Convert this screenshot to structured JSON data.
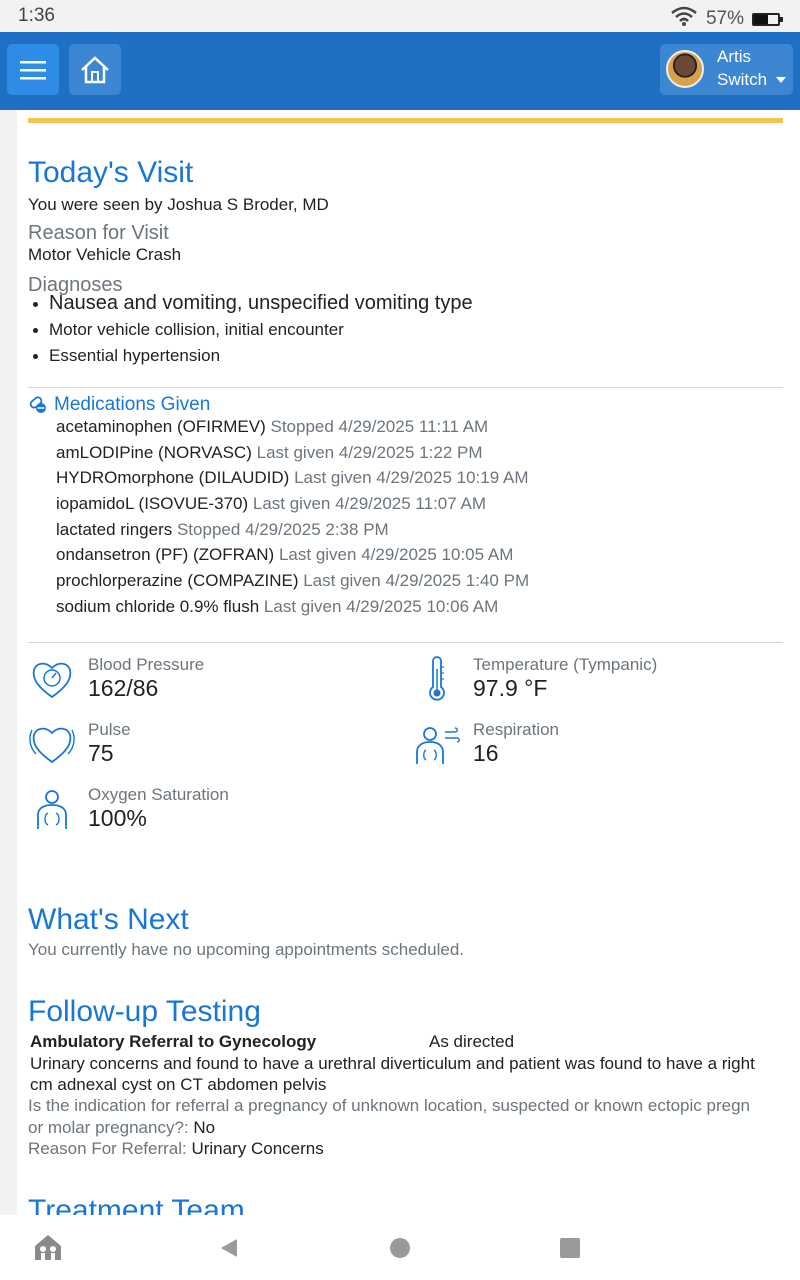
{
  "status": {
    "time": "1:36",
    "battery": "57%"
  },
  "header": {
    "user_name": "Artis",
    "switch_label": "Switch"
  },
  "visit": {
    "title": "Today's Visit",
    "seen_by": "You were seen by Joshua S Broder, MD",
    "reason_label": "Reason for Visit",
    "reason": "Motor Vehicle Crash",
    "diagnoses_label": "Diagnoses",
    "diagnoses": [
      "Nausea and vomiting, unspecified vomiting type",
      "Motor vehicle collision, initial encounter",
      "Essential hypertension"
    ]
  },
  "medications": {
    "title": "Medications Given",
    "items": [
      {
        "name": "acetaminophen (OFIRMEV)",
        "status": "Stopped 4/29/2025 11:11 AM"
      },
      {
        "name": "amLODIPine (NORVASC)",
        "status": "Last given 4/29/2025 1:22 PM"
      },
      {
        "name": "HYDROmorphone (DILAUDID)",
        "status": "Last given 4/29/2025 10:19 AM"
      },
      {
        "name": "iopamidoL (ISOVUE-370)",
        "status": "Last given 4/29/2025 11:07 AM"
      },
      {
        "name": "lactated ringers",
        "status": "Stopped 4/29/2025 2:38 PM"
      },
      {
        "name": "ondansetron (PF) (ZOFRAN)",
        "status": "Last given 4/29/2025 10:05 AM"
      },
      {
        "name": "prochlorperazine (COMPAZINE)",
        "status": "Last given 4/29/2025 1:40 PM"
      },
      {
        "name": "sodium chloride 0.9% flush",
        "status": "Last given 4/29/2025 10:06 AM"
      }
    ]
  },
  "vitals": {
    "bp": {
      "label": "Blood Pressure",
      "value": "162/86"
    },
    "temp": {
      "label": "Temperature (Tympanic)",
      "value": "97.9 °F"
    },
    "pulse": {
      "label": "Pulse",
      "value": "75"
    },
    "resp": {
      "label": "Respiration",
      "value": "16"
    },
    "o2": {
      "label": "Oxygen Saturation",
      "value": "100%"
    }
  },
  "next": {
    "title": "What's Next",
    "text": "You currently have no upcoming appointments scheduled."
  },
  "followup": {
    "title": "Follow-up Testing",
    "order": "Ambulatory Referral to Gynecology",
    "when": "As directed",
    "line1": "Urinary concerns and found to have a urethral diverticulum and patient was found to have a right",
    "line2": "cm adnexal cyst on CT abdomen pelvis",
    "q_line1": "Is the indication for referral a pregnancy of unknown location, suspected or known ectopic pregn",
    "q_line2": "or molar pregnancy?:",
    "q_answer": "No",
    "reason_label": "Reason For Referral:",
    "reason": "Urinary Concerns"
  },
  "treatment_team": {
    "title": "Treatment Team"
  }
}
